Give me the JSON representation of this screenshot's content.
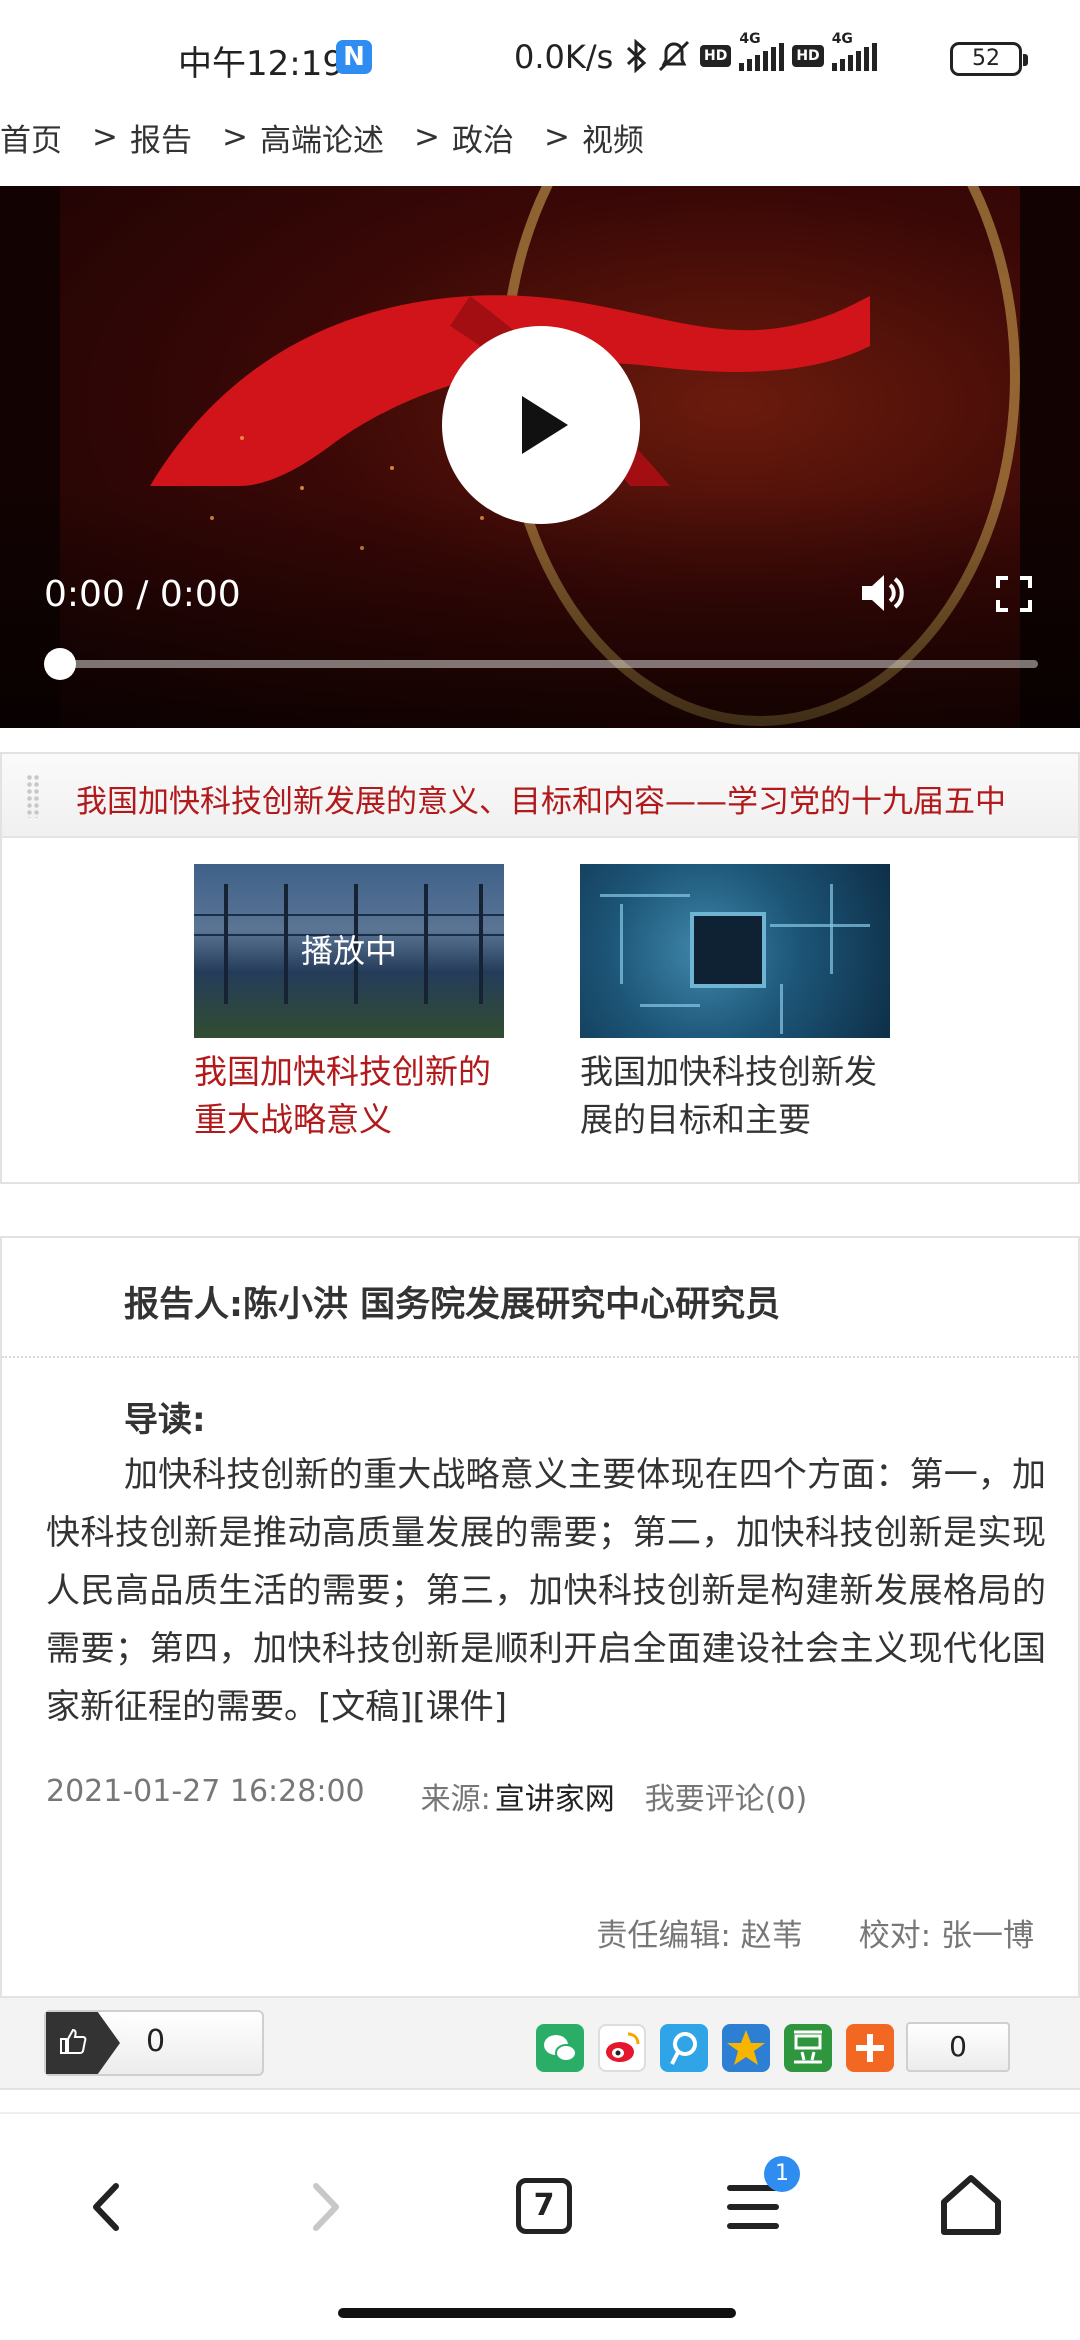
{
  "status_bar": {
    "time": "中午12:19",
    "notification_badge": "N",
    "net_speed": "0.0K/s",
    "hd_label": "HD",
    "network_label": "4G",
    "battery": "52"
  },
  "breadcrumb": {
    "items": [
      "首页",
      "报告",
      "高端论述",
      "政治",
      "视频"
    ],
    "separator": ">"
  },
  "video": {
    "time": "0:00 / 0:00",
    "progress": 0
  },
  "playlist": {
    "title": "我国加快科技创新发展的意义、目标和内容——学习党的十九届五中",
    "items": [
      {
        "caption": "我国加快科技创新的重大战略意义",
        "playing_label": "播放中",
        "active": true
      },
      {
        "caption": "我国加快科技创新发展的目标和主要",
        "active": false
      }
    ]
  },
  "article": {
    "reporter": "报告人:陈小洪 国务院发展研究中心研究员",
    "lead_label": "导读:",
    "lead_text": "加快科技创新的重大战略意义主要体现在四个方面：第一，加快科技创新是推动高质量发展的需要；第二，加快科技创新是实现人民高品质生活的需要；第三，加快科技创新是构建新发展格局的需要；第四，加快科技创新是顺利开启全面建设社会主义现代化国家新征程的需要。[文稿][课件]",
    "date": "2021-01-27 16:28:00",
    "source_label": "来源:",
    "source": "宣讲家网",
    "comment": "我要评论(0)",
    "editor": "责任编辑: 赵苇",
    "proofreader": "校对: 张一博"
  },
  "share_bar": {
    "like_count": "0",
    "share_count": "0",
    "icons": [
      {
        "name": "wechat-icon",
        "color": "#2aae67"
      },
      {
        "name": "weibo-icon",
        "color": "#e6162d"
      },
      {
        "name": "tencent-weibo-icon",
        "color": "#2fa4e7"
      },
      {
        "name": "qzone-icon",
        "color": "#f7b500"
      },
      {
        "name": "douban-icon",
        "color": "#2e963d"
      },
      {
        "name": "more-share-icon",
        "color": "#f26722"
      }
    ]
  },
  "nav_bar": {
    "tab_count": "7",
    "menu_badge": "1"
  },
  "colors": {
    "accent_red": "#b2191b",
    "badge_blue": "#2f8cf0"
  }
}
